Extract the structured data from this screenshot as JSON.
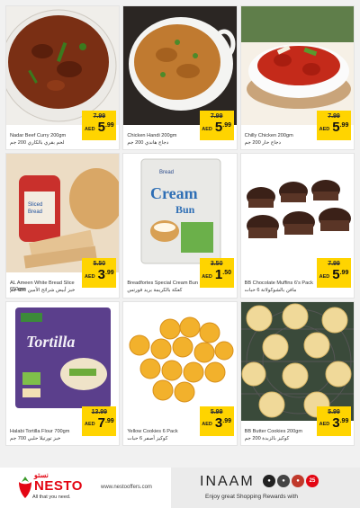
{
  "currency": "AED",
  "products": [
    {
      "name": "Nadar Beef Curry 200gm",
      "name_ar": "لحم بقري بالكاري 200 جم",
      "old_price": "7.99",
      "price_whole": "5",
      "price_frac": ".99"
    },
    {
      "name": "Chicken Handi 200gm",
      "name_ar": "دجاج هاندي 200 جم",
      "old_price": "7.99",
      "price_whole": "5",
      "price_frac": ".99"
    },
    {
      "name": "Chilly Chicken 200gm",
      "name_ar": "دجاج حار 200 جم",
      "old_price": "7.99",
      "price_whole": "5",
      "price_frac": ".99"
    },
    {
      "name": "AL Ameen White Bread Slice 650gm",
      "name_ar": "خبز أبيض شرائح الأمين 650 جم",
      "old_price": "5.50",
      "price_whole": "3",
      "price_frac": ".99"
    },
    {
      "name": "Breadfortes Special Cream Bun",
      "name_ar": "كعكة بالكريمة بريد فورتس",
      "old_price": "3.50",
      "price_whole": "1",
      "price_frac": ".50"
    },
    {
      "name": "BB Chocolate Muffins 6's Pack",
      "name_ar": "مافن بالشوكولاتة 6 حبات",
      "old_price": "7.99",
      "price_whole": "5",
      "price_frac": ".99"
    },
    {
      "name": "Halabi Tortilla Flour 700gm",
      "name_ar": "خبز تورتيلا حلبي 700 جم",
      "old_price": "13.99",
      "price_whole": "7",
      "price_frac": ".99"
    },
    {
      "name": "Yellow Cookies 6 Pack",
      "name_ar": "كوكيز أصفر 6 حبات",
      "old_price": "5.99",
      "price_whole": "3",
      "price_frac": ".99"
    },
    {
      "name": "BB Butter Cookies 200gm",
      "name_ar": "كوكيز بالزبدة 200 جم",
      "old_price": "5.99",
      "price_whole": "3",
      "price_frac": ".99"
    }
  ],
  "footer": {
    "logo_ar": "نستو",
    "logo": "NESTO",
    "tagline": "All that you need.",
    "website": "www.nestooffers.com",
    "inaam": "INAAM",
    "badge_25": "25",
    "slogan": "Enjoy great Shopping Rewards with"
  }
}
